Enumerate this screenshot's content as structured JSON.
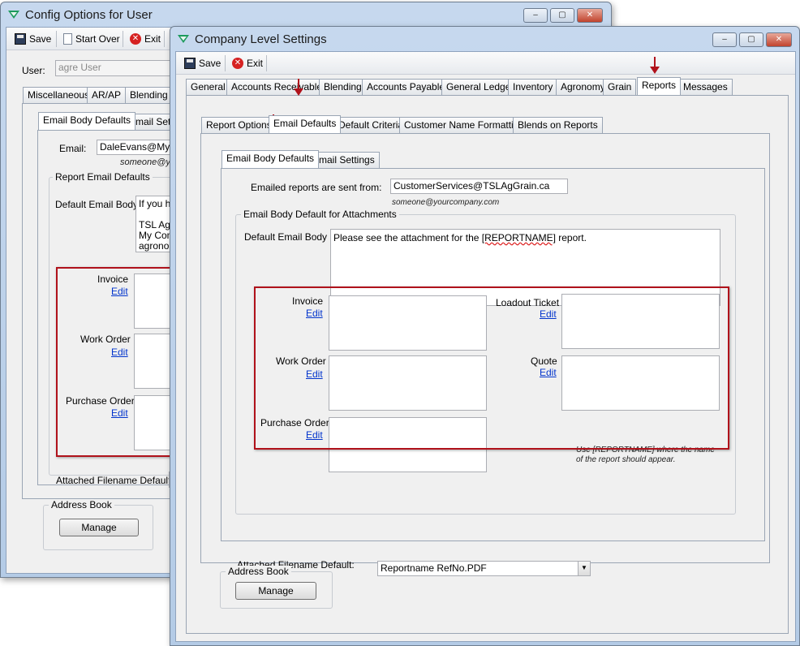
{
  "back_window": {
    "title": "Config Options for User",
    "toolbar": {
      "save": "Save",
      "start_over": "Start Over",
      "exit": "Exit"
    },
    "user_label": "User:",
    "user_value": "agre User",
    "tabs": [
      "Miscellaneous",
      "AR/AP",
      "Blending"
    ],
    "subtabs": [
      "Email Body Defaults",
      "Email Settin"
    ],
    "email_label": "Email:",
    "email_value": "DaleEvans@MyCo",
    "email_hint": "someone@yo",
    "report_group": "Report Email Defaults",
    "default_body_label": "Default Email Body",
    "default_body_lines": [
      "If you hav",
      "",
      "TSL Agro",
      "My Comp",
      "agronomi"
    ],
    "invoice_label": "Invoice",
    "work_order_label": "Work Order",
    "purchase_order_label": "Purchase Order",
    "edit_label": "Edit",
    "attached_filename_label": "Attached Filename Default:",
    "address_book_label": "Address Book",
    "manage_label": "Manage"
  },
  "front_window": {
    "title": "Company Level Settings",
    "toolbar": {
      "save": "Save",
      "exit": "Exit"
    },
    "tabs": [
      "General",
      "Accounts Receivable",
      "Blending",
      "Accounts Payable",
      "General Ledger",
      "Inventory",
      "Agronomy",
      "Grain",
      "Reports",
      "Messages"
    ],
    "active_tab": "Reports",
    "subtabs": [
      "Report Options",
      "Email Defaults",
      "Default Criteria",
      "Customer Name Formatting",
      "Blends on Reports"
    ],
    "subsubtabs": [
      "Email Body Defaults",
      "Email Settings"
    ],
    "sent_from_label": "Emailed reports are sent from:",
    "sent_from_value": "CustomerServices@TSLAgGrain.ca",
    "sent_from_hint": "someone@yourcompany.com",
    "attachments_group": "Email Body Default for Attachments",
    "default_body_label": "Default Email Body",
    "default_body_prefix": "Please see the attachment for the ",
    "default_body_token": "[REPORTNAME]",
    "default_body_suffix": " report.",
    "invoice_label": "Invoice",
    "work_order_label": "Work Order",
    "purchase_order_label": "Purchase Order",
    "loadout_label": "Loadout Ticket",
    "quote_label": "Quote",
    "edit_label": "Edit",
    "reportname_hint_1": "Use [REPORTNAME] where the name",
    "reportname_hint_2": "of the report should appear.",
    "attached_filename_label": "Attached Filename Default:",
    "attached_filename_value": "Reportname RefNo.PDF",
    "address_book_label": "Address Book",
    "manage_label": "Manage"
  },
  "colors": {
    "highlight_box": "#b0121b",
    "link": "#0033cc"
  }
}
